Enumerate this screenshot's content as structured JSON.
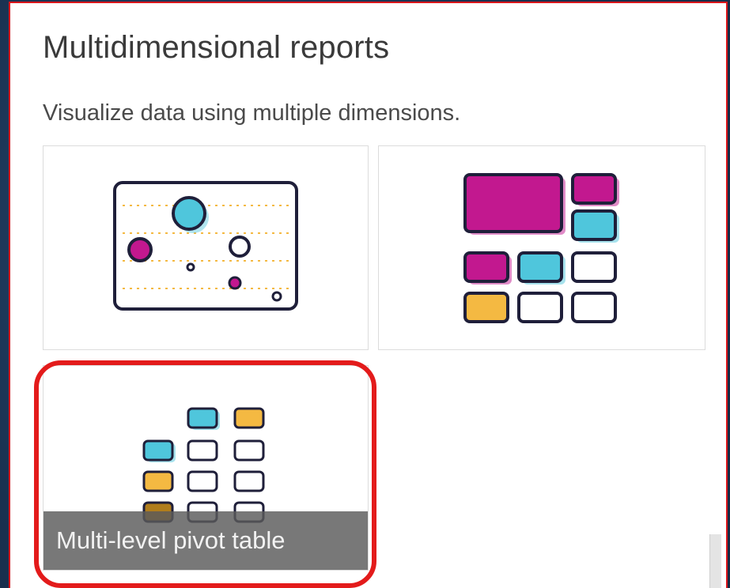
{
  "section": {
    "title": "Multidimensional reports",
    "subtitle": "Visualize data using multiple dimensions."
  },
  "tiles": [
    {
      "icon": "bubble-chart-icon"
    },
    {
      "icon": "treemap-icon"
    },
    {
      "icon": "pivot-table-icon",
      "label": "Multi-level pivot table",
      "state": "hovered"
    }
  ],
  "colors": {
    "magenta": "#c2188f",
    "cyan": "#4fc6dc",
    "amber": "#f4b942",
    "outline": "#1f1f3a",
    "highlight": "#e31b1b"
  }
}
